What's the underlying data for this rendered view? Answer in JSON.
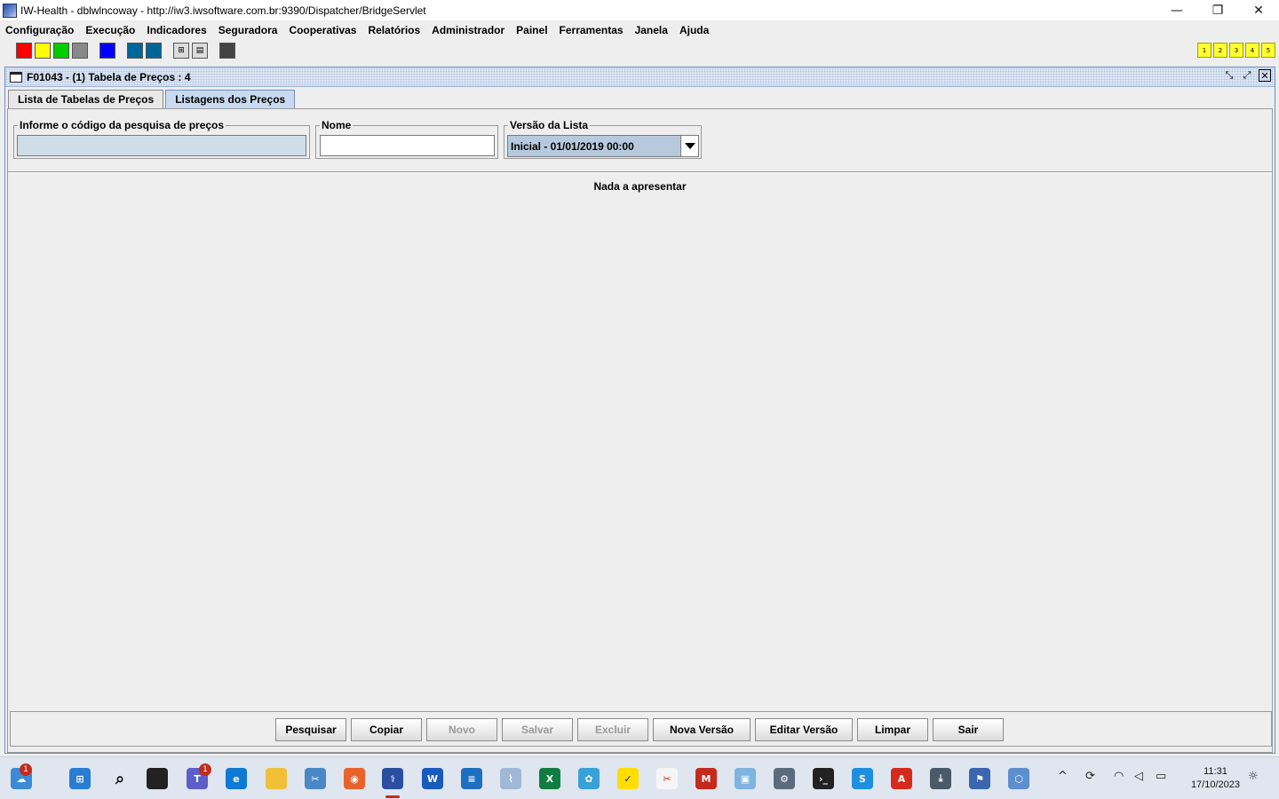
{
  "window": {
    "title": "IW-Health - dblwlncoway - http://iw3.iwsoftware.com.br:9390/Dispatcher/BridgeServlet",
    "minimize": "—",
    "restore": "❐",
    "close": "✕"
  },
  "menu": [
    "Configuração",
    "Execução",
    "Indicadores",
    "Seguradora",
    "Cooperativas",
    "Relatórios",
    "Administrador",
    "Painel",
    "Ferramentas",
    "Janela",
    "Ajuda"
  ],
  "toolbar": {
    "swatches": [
      "#ff0000",
      "#ffff00",
      "#00cc00",
      "#888888",
      "#0000ff",
      "#006699",
      "#006699",
      "#444444"
    ],
    "numbers": [
      "1",
      "2",
      "3",
      "4",
      "5"
    ]
  },
  "frame": {
    "title": "F01043 - (1) Tabela de Preços : 4",
    "tabs": [
      {
        "label": "Lista de Tabelas de Preços",
        "active": false
      },
      {
        "label": "Listagens dos Preços",
        "active": true
      }
    ],
    "fields": {
      "codigo_label": "Informe o código da pesquisa de preços",
      "codigo_value": "",
      "nome_label": "Nome",
      "nome_value": "",
      "versao_label": "Versão da Lista",
      "versao_value": "Inicial - 01/01/2019 00:00"
    },
    "empty_message": "Nada a apresentar",
    "buttons": {
      "pesquisar": "Pesquisar",
      "copiar": "Copiar",
      "novo": "Novo",
      "salvar": "Salvar",
      "excluir": "Excluir",
      "nova_versao": "Nova Versão",
      "editar_versao": "Editar Versão",
      "limpar": "Limpar",
      "sair": "Sair"
    }
  },
  "taskbar": {
    "weather_badge": "1",
    "teams_badge": "1",
    "time": "11:31",
    "date": "17/10/2023",
    "colors": {
      "accent": "#c42b1c",
      "active_underline": "#c42b1c"
    }
  }
}
